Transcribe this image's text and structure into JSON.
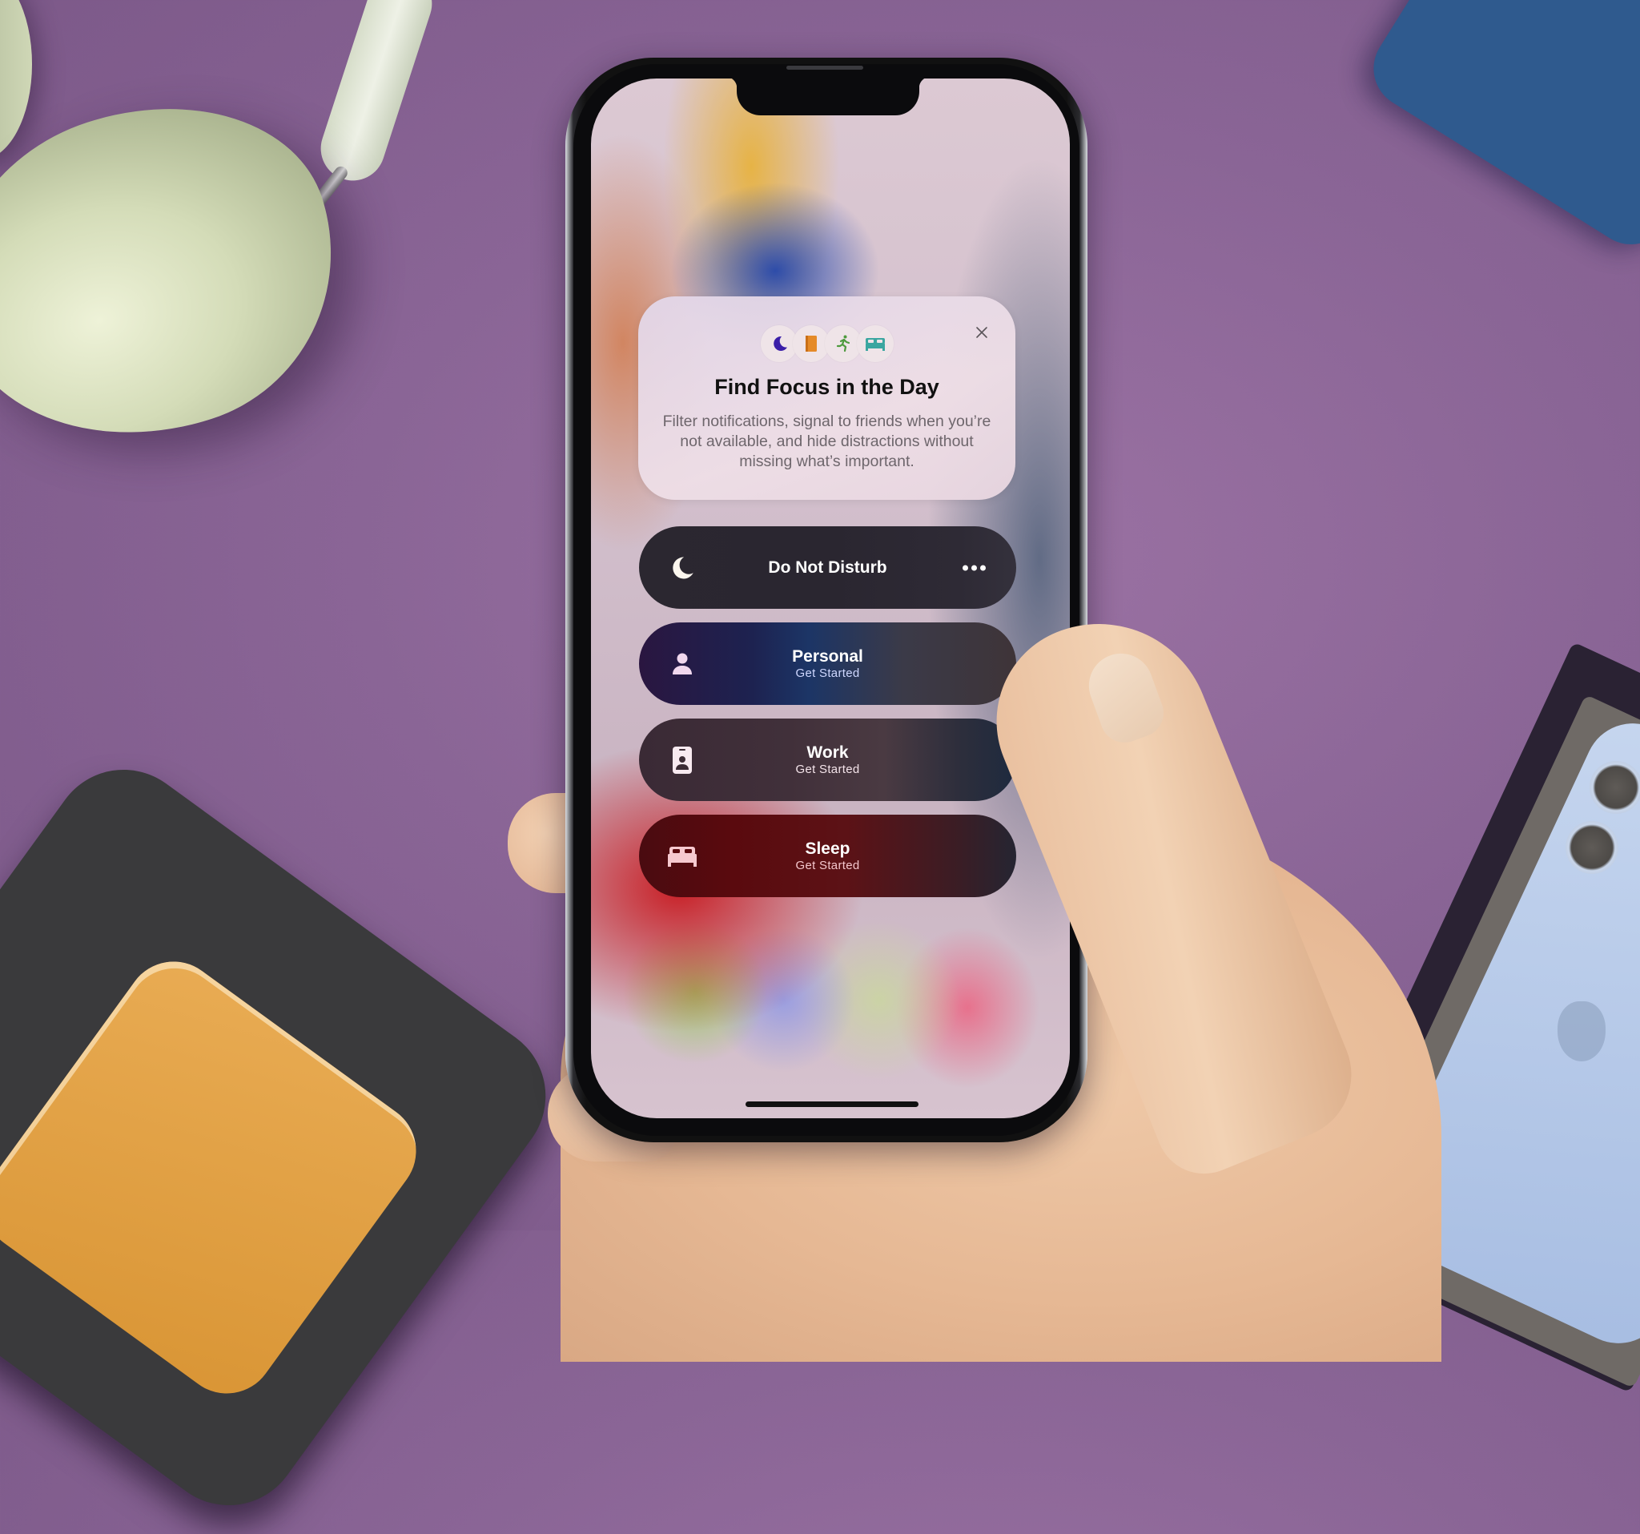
{
  "screen": "Focus onboarding",
  "focus_card": {
    "title": "Find Focus in the Day",
    "body": "Filter notifications, signal to friends when you’re not available, and hide distractions without missing what’s important.",
    "icons": [
      {
        "name": "moon-icon",
        "color": "#3a1ea8"
      },
      {
        "name": "book-icon",
        "color": "#e58a27"
      },
      {
        "name": "running-figure-icon",
        "color": "#4e9a3e"
      },
      {
        "name": "bed-icon",
        "color": "#3aa6a0"
      }
    ],
    "close_icon": "close-icon"
  },
  "focus_modes": [
    {
      "id": "do-not-disturb",
      "title": "Do Not Disturb",
      "subtitle": null,
      "icon": "moon-icon",
      "more_icon": "ellipsis-icon"
    },
    {
      "id": "personal",
      "title": "Personal",
      "subtitle": "Get Started",
      "icon": "person-icon",
      "subtitle_color": "#cfd8ff"
    },
    {
      "id": "work",
      "title": "Work",
      "subtitle": "Get Started",
      "icon": "id-badge-icon",
      "subtitle_color": "#f4e4ea"
    },
    {
      "id": "sleep",
      "title": "Sleep",
      "subtitle": "Get Started",
      "icon": "bed-icon",
      "subtitle_color": "#f3c6cc"
    }
  ],
  "colors": {
    "background_purple": "#8a6596",
    "pill_text": "#ffffff",
    "card_title": "#111111",
    "card_body": "#6e666c"
  }
}
